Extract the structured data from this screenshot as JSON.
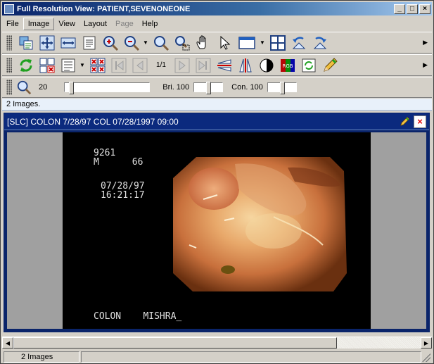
{
  "window": {
    "title": "Full Resolution View: PATIENT,SEVENONEONE",
    "minimize": "_",
    "maximize": "□",
    "close": "×"
  },
  "menu": {
    "items": [
      {
        "label": "File",
        "state": "normal"
      },
      {
        "label": "Image",
        "state": "active"
      },
      {
        "label": "View",
        "state": "normal"
      },
      {
        "label": "Layout",
        "state": "normal"
      },
      {
        "label": "Page",
        "state": "disabled"
      },
      {
        "label": "Help",
        "state": "normal"
      }
    ]
  },
  "toolbar2": {
    "page_indicator": "1/1"
  },
  "toolbar3": {
    "zoom_value": "20",
    "brightness_label": "Bri. 100",
    "contrast_label": "Con. 100",
    "zoom_level": 0.05,
    "brightness_level": 0.5,
    "contrast_level": 0.5
  },
  "images_count_text": "2 Images.",
  "image_panel": {
    "header": "[SLC] COLON  7/28/97 COL 07/28/1997 09:00",
    "overlay": {
      "id_line": "9261",
      "patient_line": "M      66",
      "date_line": "07/28/97",
      "time_line": "16:21:17",
      "footer_line": "COLON    MISHRA_"
    }
  },
  "statusbar": {
    "pane1": "2 Images",
    "pane2": ""
  },
  "colors": {
    "title_gradient_start": "#0a246a",
    "panel_border": "#0a246a",
    "window_bg": "#d4d0c8"
  }
}
